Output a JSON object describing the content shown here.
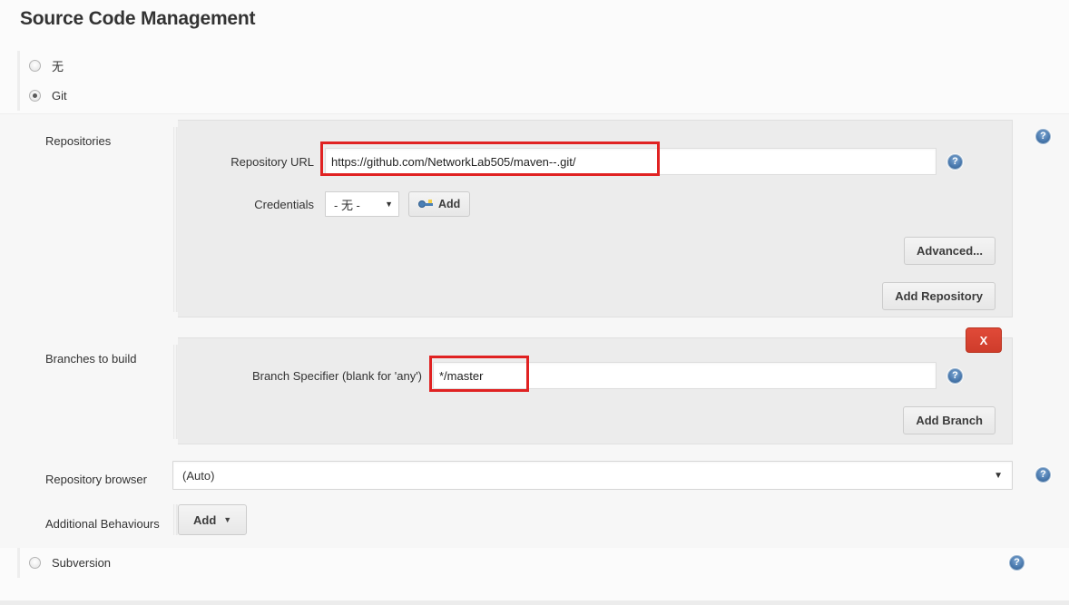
{
  "page": {
    "title": "Source Code Management"
  },
  "scm_options": [
    {
      "label": "无",
      "selected": false,
      "name": "none"
    },
    {
      "label": "Git",
      "selected": true,
      "name": "git"
    },
    {
      "label": "Subversion",
      "selected": false,
      "name": "subversion"
    }
  ],
  "git": {
    "repositories": {
      "label": "Repositories",
      "repository_url": {
        "label": "Repository URL",
        "value": "https://github.com/NetworkLab505/maven--.git/",
        "placeholder": "",
        "highlighted": true
      },
      "credentials": {
        "label": "Credentials",
        "selected": "- 无 -",
        "options": [
          "- 无 -"
        ],
        "add_button": "Add",
        "add_icon": "key-icon"
      },
      "advanced_button": "Advanced...",
      "add_repository_button": "Add Repository"
    },
    "branches": {
      "label": "Branches to build",
      "branch_specifier": {
        "label": "Branch Specifier (blank for 'any')",
        "value": "*/master",
        "placeholder": "",
        "highlighted": true
      },
      "delete_button": "X",
      "add_branch_button": "Add Branch"
    },
    "repository_browser": {
      "label": "Repository browser",
      "selected": "(Auto)",
      "options": [
        "(Auto)"
      ]
    },
    "additional_behaviours": {
      "label": "Additional Behaviours",
      "add_button": "Add"
    }
  },
  "icons": {
    "help": "?",
    "caret_down": "▼",
    "button_caret": "▼"
  },
  "colors": {
    "highlight_red": "#e02222",
    "delete_red": "#cf3c2b",
    "help_blue": "#2d5b8e",
    "panel_bg": "#ececec",
    "page_bg": "#fbfbfb"
  }
}
